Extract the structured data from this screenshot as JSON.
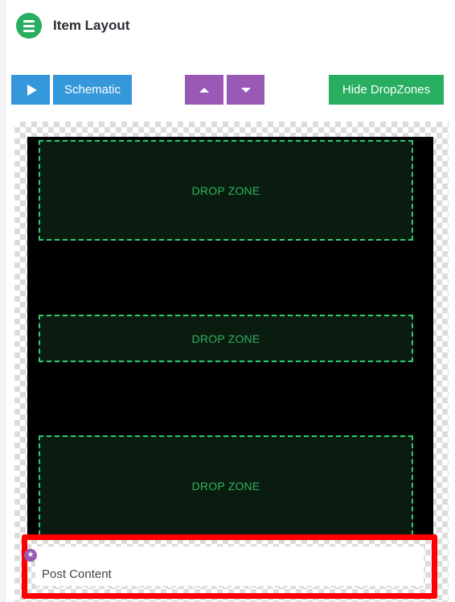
{
  "header": {
    "title": "Item Layout",
    "menu_icon": "hamburger-menu-icon"
  },
  "toolbar": {
    "play_icon": "play-icon",
    "schematic_label": "Schematic",
    "move_up_icon": "caret-up-icon",
    "move_down_icon": "caret-down-icon",
    "hide_dropzones_label": "Hide DropZones"
  },
  "canvas": {
    "drop_zones": [
      {
        "label": "DROP ZONE"
      },
      {
        "label": "DROP ZONE"
      },
      {
        "label": "DROP ZONE"
      }
    ],
    "selected_item": {
      "label": "Post Content",
      "marker_icon": "star-icon"
    }
  },
  "colors": {
    "accent_green": "#27ae60",
    "button_blue": "#3498db",
    "button_purple": "#9b59b6",
    "selection_red": "#ff0000",
    "dropzone_border": "#2ecc71",
    "canvas_black": "#000000"
  }
}
